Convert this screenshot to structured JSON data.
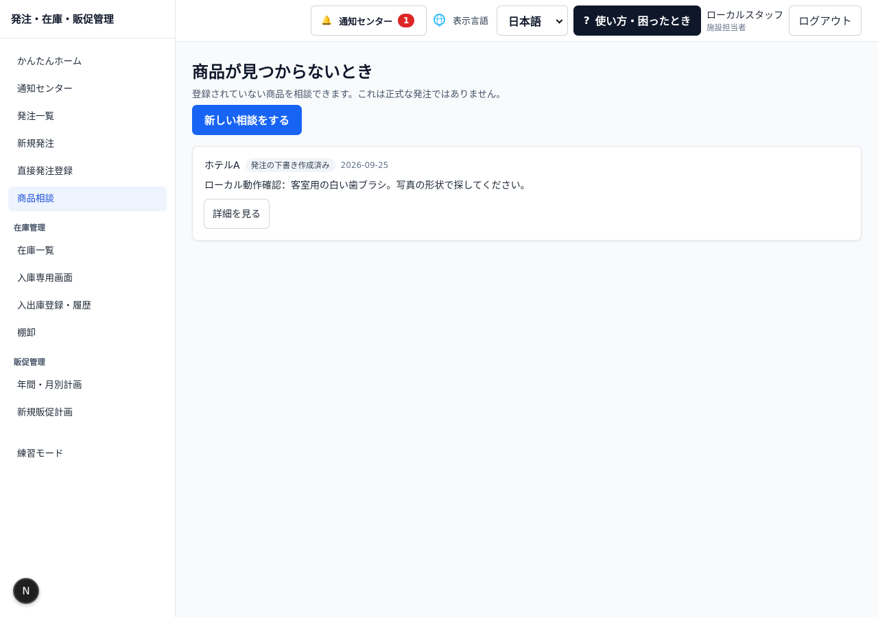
{
  "app": {
    "title": "発注・在庫・販促管理"
  },
  "sidebar": {
    "main_items": [
      {
        "label": "かんたんホーム"
      },
      {
        "label": "通知センター"
      },
      {
        "label": "発注一覧"
      },
      {
        "label": "新規発注"
      },
      {
        "label": "直接発注登録"
      },
      {
        "label": "商品相談",
        "active": true
      }
    ],
    "inventory": {
      "heading": "在庫管理",
      "items": [
        {
          "label": "在庫一覧"
        },
        {
          "label": "入庫専用画面"
        },
        {
          "label": "入出庫登録・履歴"
        },
        {
          "label": "棚卸"
        }
      ]
    },
    "promotion": {
      "heading": "販促管理",
      "items": [
        {
          "label": "年間・月別計画"
        },
        {
          "label": "新規販促計画"
        }
      ]
    },
    "practice": {
      "label": "練習モード"
    },
    "badge": {
      "letter": "N"
    }
  },
  "header": {
    "notification": {
      "label": "通知センター",
      "count": "1",
      "icon": "bell-icon"
    },
    "language": {
      "label": "表示言語",
      "selected": "日本語",
      "icon": "globe-icon"
    },
    "help": {
      "label": "使い方・困ったとき",
      "mark": "?"
    },
    "user": {
      "name": "ローカルスタッフ",
      "role": "施設担当者"
    },
    "logout": {
      "label": "ログアウト"
    }
  },
  "main": {
    "title": "商品が見つからないとき",
    "subtitle": "登録されていない商品を相談できます。これは正式な発注ではありません。",
    "new_button": "新しい相談をする",
    "consultations": [
      {
        "facility": "ホテルA",
        "status": "発注の下書き作成済み",
        "date": "2026-09-25",
        "description": "ローカル動作確認：客室用の白い歯ブラシ。写真の形状で探してください。",
        "detail_button": "詳細を見る"
      }
    ]
  },
  "colors": {
    "primary": "#1764f4",
    "dark": "#0f172a",
    "active_bg": "#eef4fd",
    "active_text": "#1d4ed8",
    "alert": "#dc2626"
  }
}
